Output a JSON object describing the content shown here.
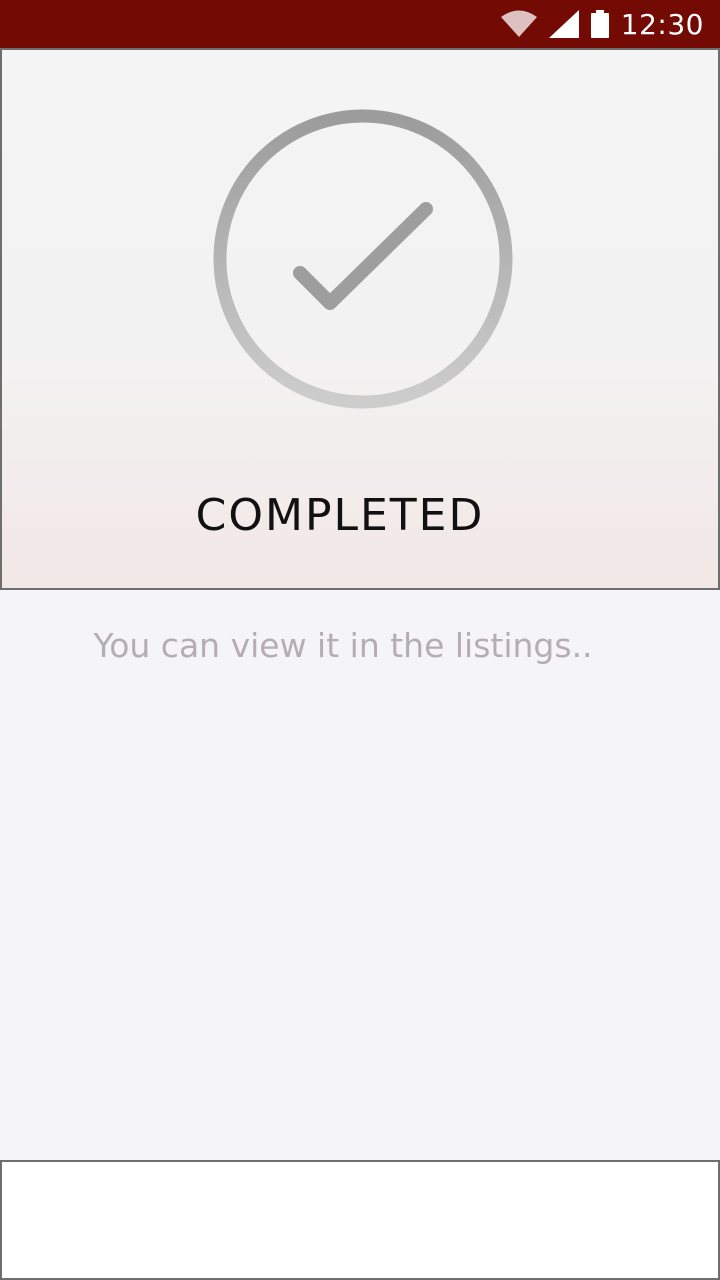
{
  "status_bar": {
    "time": "12:30",
    "icons": [
      "wifi-icon",
      "cellular-signal-icon",
      "battery-icon"
    ],
    "background": "#730a04"
  },
  "hero": {
    "icon": "check-circle-icon",
    "title": "COMPLETED"
  },
  "message": {
    "text": "You can view it in the listings.."
  },
  "colors": {
    "accent": "#730a04",
    "icon_gray": "#a0a0a0",
    "subtitle_gray": "#b4aeb2",
    "page_background": "#f5f4f9"
  }
}
